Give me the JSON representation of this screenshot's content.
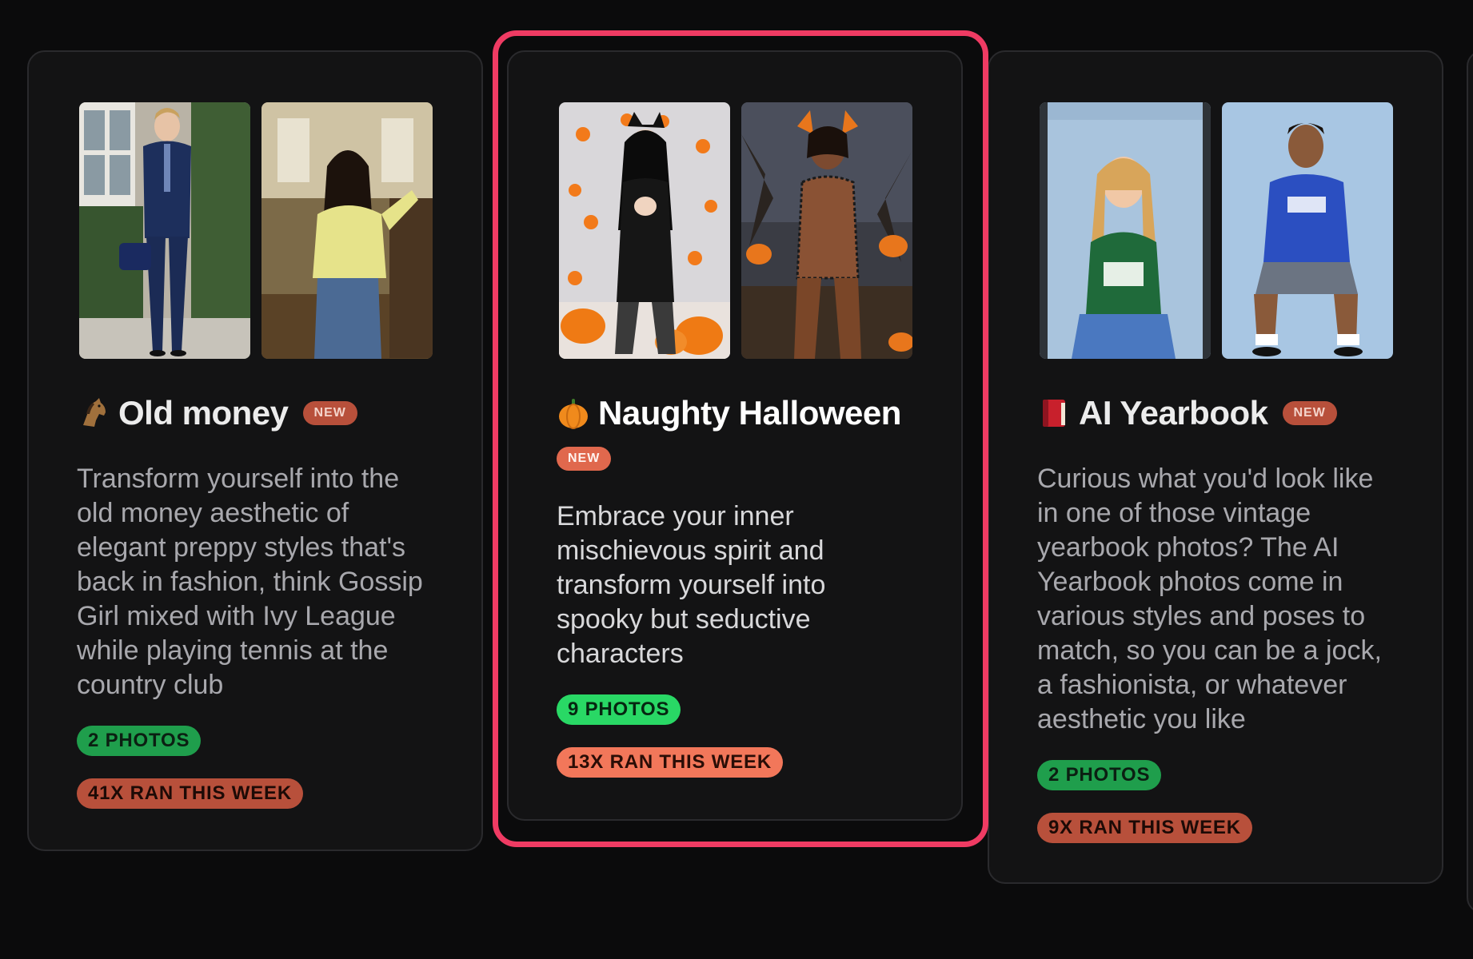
{
  "cards": [
    {
      "emoji_icon": "horse-icon",
      "title": "Old money",
      "badge": "NEW",
      "description": "Transform yourself into the old money aesthetic of elegant preppy styles that's back in fashion, think Gossip Girl mixed with Ivy League while playing tennis at the country club",
      "photos": "2 PHOTOS",
      "ran": "41X RAN THIS WEEK",
      "thumbnails": [
        "man-in-navy-suit-photo",
        "woman-in-yellow-sweater-photo"
      ]
    },
    {
      "emoji_icon": "pumpkin-icon",
      "title": "Naughty Halloween",
      "badge": "NEW",
      "description": "Embrace your inner mischievous spirit and transform yourself into spooky but seductive characters",
      "photos": "9 PHOTOS",
      "ran": "13X RAN THIS WEEK",
      "thumbnails": [
        "woman-in-cat-costume-photo",
        "woman-in-lace-costume-photo"
      ],
      "highlighted": true,
      "highlight_color": "#ef3b63"
    },
    {
      "emoji_icon": "red-book-icon",
      "title": "AI Yearbook",
      "badge": "NEW",
      "description": "Curious what you'd look like in one of those vintage yearbook photos? The AI Yearbook photos come in various styles and poses to match, so you can be a jock, a fashionista, or whatever aesthetic you like",
      "photos": "2 PHOTOS",
      "ran": "9X RAN THIS WEEK",
      "thumbnails": [
        "girl-yearbook-photo",
        "boy-yearbook-photo"
      ]
    }
  ],
  "colors": {
    "background": "#0b0b0c",
    "card": "#131314",
    "new_badge": "#e0684d",
    "photos_pill": "#29d865",
    "ran_pill": "#f2775a",
    "highlight": "#ef3b63"
  }
}
